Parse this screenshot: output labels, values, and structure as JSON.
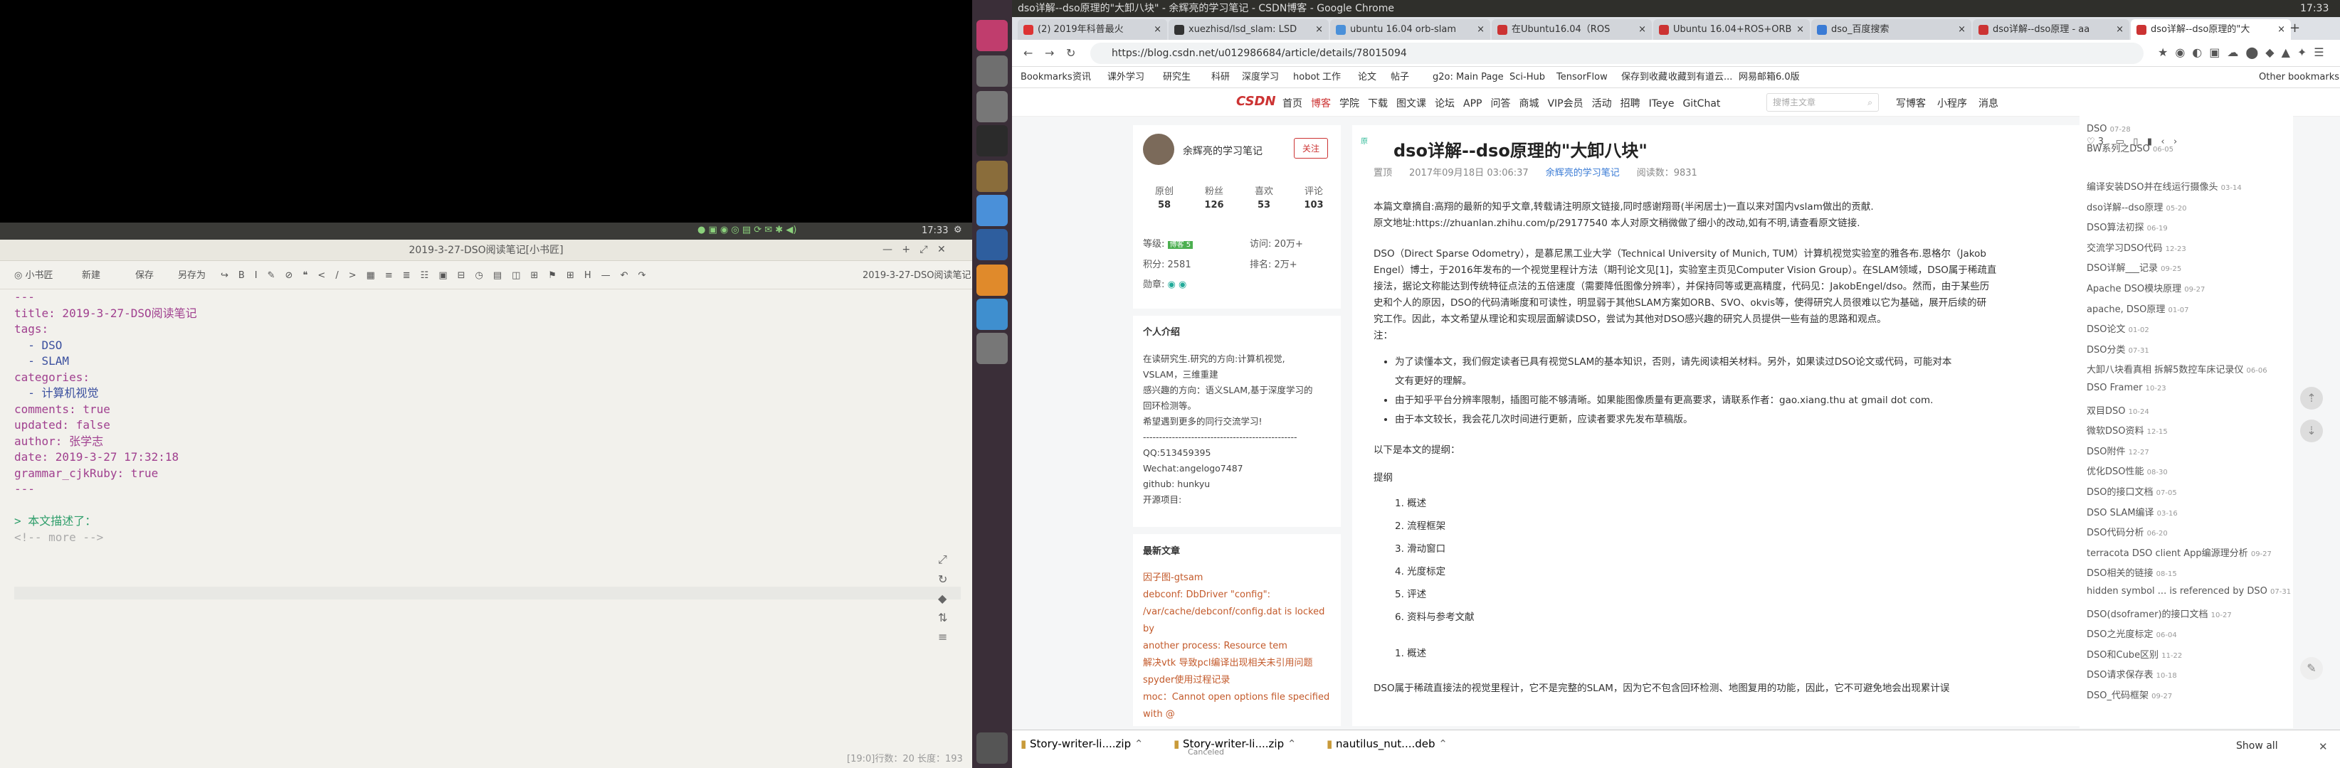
{
  "editor": {
    "window_title": "2019-3-27-DSO阅读笔记[小书匠]",
    "clock": "17:33",
    "toolbar": [
      "新建",
      "保存",
      "另存为"
    ],
    "toolbar_right": "2019-3-27-DSO阅读笔记",
    "lines": [
      {
        "t": "---",
        "c": "mark"
      },
      {
        "t": "title: 2019-3-27-DSO阅读笔记",
        "c": "mark"
      },
      {
        "t": "tags:",
        "c": "mark"
      },
      {
        "t": "  - DSO",
        "c": "val"
      },
      {
        "t": "  - SLAM",
        "c": "val"
      },
      {
        "t": "categories:",
        "c": "mark"
      },
      {
        "t": "  - 计算机视觉",
        "c": "val"
      },
      {
        "t": "comments: true",
        "c": "mark"
      },
      {
        "t": "updated: false",
        "c": "mark"
      },
      {
        "t": "author: 张学志",
        "c": "mark"
      },
      {
        "t": "date: 2019-3-27 17:32:18",
        "c": "mark"
      },
      {
        "t": "grammar_cjkRuby: true",
        "c": "mark"
      },
      {
        "t": "---",
        "c": "mark"
      },
      {
        "t": "",
        "c": ""
      },
      {
        "t": "> 本文描述了：",
        "c": "hd"
      },
      {
        "t": "<!-- more -->",
        "c": "com"
      }
    ],
    "status": "[19:0]行数：20 长度：193"
  },
  "chrome": {
    "title": "dso详解--dso原理的\"大卸八块\" - 余辉亮的学习笔记 - CSDN博客 - Google Chrome",
    "clock": "17:33",
    "tabs": [
      "(2) 2019年科普最火",
      "xuezhisd/lsd_slam: LSD",
      "ubuntu 16.04 orb-slam",
      "在Ubuntu16.04（ROS",
      "Ubuntu 16.04+ROS+ORB",
      "dso_百度搜索",
      "dso详解--dso原理 - aa",
      "dso详解--dso原理的\"大"
    ],
    "url": "https://blog.csdn.net/u012986684/article/details/78015094",
    "bookmarks": [
      "Bookmarks",
      "资讯",
      "课外学习",
      "研究生",
      "科研",
      "深度学习",
      "hobot",
      "工作",
      "论文",
      "帖子",
      "g2o: Main Page",
      "Sci-Hub",
      "TensorFlow",
      "保存到收藏",
      "收藏到有道云...",
      "网易邮箱6.0版",
      "Other bookmarks"
    ],
    "csdn_nav": [
      "首页",
      "博客",
      "学院",
      "下载",
      "图文课",
      "论坛",
      "APP",
      "问答",
      "商城",
      "VIP会员",
      "活动",
      "招聘",
      "ITeye",
      "GitChat"
    ],
    "csdn_right": [
      "写博客",
      "小程序",
      "消息"
    ],
    "search_placeholder": "搜博主文章",
    "profile": {
      "name": "余辉亮的学习笔记",
      "follow": "关注",
      "stats": [
        {
          "l": "原创",
          "v": "58"
        },
        {
          "l": "粉丝",
          "v": "126"
        },
        {
          "l": "喜欢",
          "v": "53"
        },
        {
          "l": "评论",
          "v": "103"
        }
      ],
      "level": "等级:",
      "visits": "访问:  20万+",
      "points": "积分:  2581",
      "rank": "排名:  2万+",
      "medal": "勋章:",
      "intro_title": "个人介绍",
      "intro": [
        "在读研究生.研究的方向:计算机视觉,",
        "VSLAM，三维重建",
        "感兴趣的方向：语义SLAM,基于深度学习的",
        "回环检测等。",
        "希望遇到更多的同行交流学习!",
        "------------------------------------------------",
        "QQ:513459395",
        "Wechat:angelogo7487",
        "github: hunkyu",
        "开源项目:"
      ],
      "recent_title": "最新文章",
      "recent": [
        "因子图-gtsam",
        "debconf: DbDriver \"config\":",
        "/var/cache/debconf/config.dat is locked by",
        "another process: Resource tem",
        "解决vtk 导致pcl编译出现相关未引用问题",
        "spyder使用过程记录",
        "moc：Cannot open options file specified",
        "with @"
      ]
    },
    "article": {
      "title": "dso详解--dso原理的\"大卸八块\"",
      "meta": [
        "置顶",
        "2017年09月18日 03:06:37",
        "余辉亮的学习笔记",
        "阅读数：9831"
      ],
      "p1": "本篇文章摘自:高翔的最新的知乎文章,转载请注明原文链接,同时感谢翔哥(半闲居士)一直以来对国内vslam做出的贡献.",
      "p2": "原文地址:https://zhuanlan.zhihu.com/p/29177540 本人对原文稍微做了细小的改动,如有不明,请查看原文链接.",
      "p3": [
        "DSO（Direct Sparse Odometry），是慕尼黑工业大学（Technical University of Munich, TUM）计算机视觉实验室的雅各布.恩格尔（Jakob",
        "Engel）博士，于2016年发布的一个视觉里程计方法（期刊论文见[1]，实验室主页见Computer Vision Group）。在SLAM领域，DSO属于稀疏直",
        "接法，据论文称能达到传统特征点法的五倍速度（需要降低图像分辨率），并保持同等或更高精度，代码见：JakobEngel/dso。然而，由于某些历",
        "史和个人的原因，DSO的代码清晰度和可读性，明显弱于其他SLAM方案如ORB、SVO、okvis等，使得研究人员很难以它为基础，展开后续的研",
        "究工作。因此，本文希望从理论和实现层面解读DSO，尝试为其他对DSO感兴趣的研究人员提供一些有益的思路和观点。",
        "注："
      ],
      "bullets": [
        "为了读懂本文，我们假定读者已具有视觉SLAM的基本知识，否则，请先阅读相关材料。另外，如果读过DSO论文或代码，可能对本",
        "文有更好的理解。",
        "由于知乎平台分辨率限制，插图可能不够清晰。如果能图像质量有更高要求，请联系作者：gao.xiang.thu at gmail dot com.",
        "由于本文较长，我会花几次时间进行更新，应读者要求先发布草稿版。"
      ],
      "outline_lead": "以下是本文的提纲：",
      "outline_title": "提纲",
      "outline": [
        "1. 概述",
        "2. 流程框架",
        "3. 滑动窗口",
        "4. 光度标定",
        "5. 评述",
        "6. 资料与参考文献"
      ],
      "section": "1. 概述",
      "cut": "DSO属于稀疏直接法的视觉里程计，它不是完整的SLAM，因为它不包含回环检测、地图复用的功能，因此，它不可避免地会出现累计误"
    },
    "rightcol": [
      [
        "DSO",
        "07-28"
      ],
      [
        "BW系列之DSO",
        "06-05"
      ],
      [
        "编译安装DSO并在线运行摄像头",
        "03-14"
      ],
      [
        "dso详解--dso原理",
        "05-20"
      ],
      [
        "DSO算法初探",
        "06-19"
      ],
      [
        "交流学习DSO代码",
        "12-23"
      ],
      [
        "DSO详解___记录",
        "09-25"
      ],
      [
        "Apache DSO模块原理",
        "09-27"
      ],
      [
        "apache, DSO原理",
        "01-07"
      ],
      [
        "DSO论文",
        "01-02"
      ],
      [
        "DSO分类",
        "07-31"
      ],
      [
        "大卸八块看真相 拆解5数控车床记录仪",
        "06-06"
      ],
      [
        "DSO Framer",
        "10-23"
      ],
      [
        "双目DSO",
        "10-24"
      ],
      [
        "微软DSO资料",
        "12-15"
      ],
      [
        "DSO附件",
        "12-27"
      ],
      [
        "优化DSO性能",
        "08-30"
      ],
      [
        "DSO的接口文档",
        "07-05"
      ],
      [
        "DSO SLAM编译",
        "03-16"
      ],
      [
        "DSO代码分析",
        "06-20"
      ],
      [
        "terracota DSO client App编源理分析",
        "09-27"
      ],
      [
        "DSO相关的链接",
        "08-15"
      ],
      [
        "hidden symbol ... is referenced by DSO",
        "07-31"
      ],
      [
        "DSO(dsoframer)的接口文档",
        "10-27"
      ],
      [
        "DSO之光度标定",
        "06-04"
      ],
      [
        "DSO和Cube区别",
        "11-22"
      ],
      [
        "DSO请求保存表",
        "10-18"
      ],
      [
        "DSO_代码框架",
        "09-27"
      ]
    ],
    "like_count": "3",
    "downloads": [
      {
        "n": "Story-writer-li....zip",
        "s": ""
      },
      {
        "n": "Story-writer-li....zip",
        "s": "Canceled"
      },
      {
        "n": "nautilus_nut....deb",
        "s": ""
      }
    ],
    "show_all": "Show all"
  }
}
